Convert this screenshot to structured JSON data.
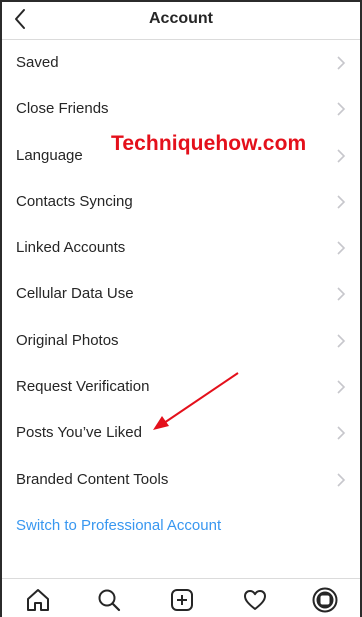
{
  "header": {
    "title": "Account",
    "back_icon": "chevron-left-icon"
  },
  "items": [
    {
      "label": "Saved"
    },
    {
      "label": "Close Friends"
    },
    {
      "label": "Language"
    },
    {
      "label": "Contacts Syncing"
    },
    {
      "label": "Linked Accounts"
    },
    {
      "label": "Cellular Data Use"
    },
    {
      "label": "Original Photos"
    },
    {
      "label": "Request Verification"
    },
    {
      "label": "Posts You’ve Liked"
    },
    {
      "label": "Branded Content Tools"
    }
  ],
  "switch_account": {
    "label": "Switch to Professional Account"
  },
  "watermark": {
    "text": "Techniquehow.com"
  },
  "colors": {
    "link": "#3897f0",
    "watermark": "#e4101b",
    "arrow": "#e4101b",
    "chevron": "#c7c7cc"
  },
  "tabbar": {
    "items": [
      {
        "icon": "home-icon"
      },
      {
        "icon": "search-icon"
      },
      {
        "icon": "add-post-icon"
      },
      {
        "icon": "heart-icon"
      },
      {
        "icon": "profile-avatar-icon"
      }
    ]
  }
}
